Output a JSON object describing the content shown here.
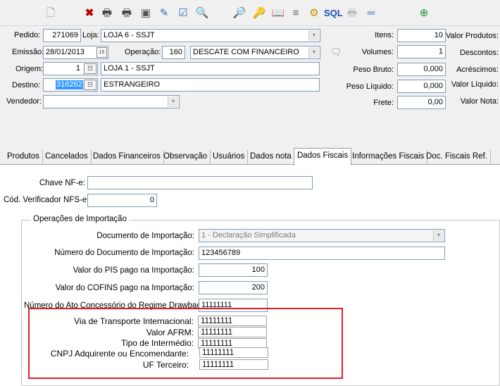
{
  "toolbar": {
    "icons": [
      "new-document-icon",
      "delete-icon",
      "print-icon",
      "print-preview-icon",
      "disk-icon",
      "edit-icon",
      "checklist-icon",
      "binoculars-icon",
      "zoom-document-icon",
      "keys-icon",
      "book-icon",
      "stack-icon",
      "gears-icon",
      "sql-icon",
      "printer-disabled-icon",
      "separator-icon",
      "target-icon"
    ],
    "sql_label": "SQL"
  },
  "header": {
    "pedido_label": "Pedido:",
    "pedido_value": "271069",
    "loja_label": "Loja:",
    "loja_value": "LOJA 6 - SSJT",
    "emissao_label": "Emissão:",
    "emissao_value": "28/01/2013",
    "operacao_label": "Operação:",
    "operacao_code": "160",
    "operacao_value": "DESCATE COM FINANCEIRO",
    "origem_label": "Origem:",
    "origem_code": "1",
    "origem_value": "LOJA 1 - SSJT",
    "destino_label": "Destino:",
    "destino_code": "316262",
    "destino_value": "ESTRANGEIRO",
    "vendedor_label": "Vendedor:",
    "vendedor_value": "",
    "itens_label": "Itens:",
    "itens_value": "10",
    "volumes_label": "Volumes:",
    "volumes_value": "1",
    "peso_bruto_label": "Peso Bruto:",
    "peso_bruto_value": "0,000",
    "peso_liquido_label": "Peso Líquido:",
    "peso_liquido_value": "0,000",
    "frete_label": "Frete:",
    "frete_value": "0,00",
    "valor_produtos_label": "Valor Produtos:",
    "descontos_label": "Descontos:",
    "acrescimos_label": "Acréscimos:",
    "valor_liquido_label": "Valor Líquido:",
    "valor_nota_label": "Valor Nota:"
  },
  "tabs": [
    {
      "label": "Produtos",
      "active": false
    },
    {
      "label": "Cancelados",
      "active": false
    },
    {
      "label": "Dados Financeiros",
      "active": false
    },
    {
      "label": "Observação",
      "active": false
    },
    {
      "label": "Usuários",
      "active": false
    },
    {
      "label": "Dados nota",
      "active": false
    },
    {
      "label": "Dados Fiscais",
      "active": true
    },
    {
      "label": "Informações Fiscais",
      "active": false
    },
    {
      "label": "Doc. Fiscais Ref.",
      "active": false
    }
  ],
  "fiscal": {
    "chave_nfe_label": "Chave NF-e:",
    "chave_nfe_value": "",
    "cod_verificador_label": "Cód. Verificador NFS-e:",
    "cod_verificador_value": "0",
    "group_title": "Operações de Importação",
    "doc_importacao_label": "Documento de Importação:",
    "doc_importacao_value": "1 - Declaração Simplificada",
    "num_doc_label": "Número do Documento de Importação:",
    "num_doc_value": "123456789",
    "pis_label": "Valor do PIS pago na Importação:",
    "pis_value": "100",
    "cofins_label": "Valor do COFINS pago na Importação:",
    "cofins_value": "200",
    "drawback_label": "Número do Ato Concessório do Regime Drawback:",
    "drawback_value": "11111111",
    "via_transporte_label": "Via de Transporte Internacional:",
    "via_transporte_value": "11111111",
    "valor_afrm_label": "Valor AFRM:",
    "valor_afrm_value": "11111111",
    "tipo_intermedio_label": "Tipo de Intermédio:",
    "tipo_intermedio_value": "11111111",
    "cnpj_label": "CNPJ Adquirente ou Encomendante:",
    "cnpj_value": "11111111",
    "uf_terceiro_label": "UF Terceiro:",
    "uf_terceiro_value": "11111111"
  },
  "colors": {
    "highlight_box": "#e01f26",
    "selection": "#3399ff",
    "field_border": "#7f9db9"
  }
}
